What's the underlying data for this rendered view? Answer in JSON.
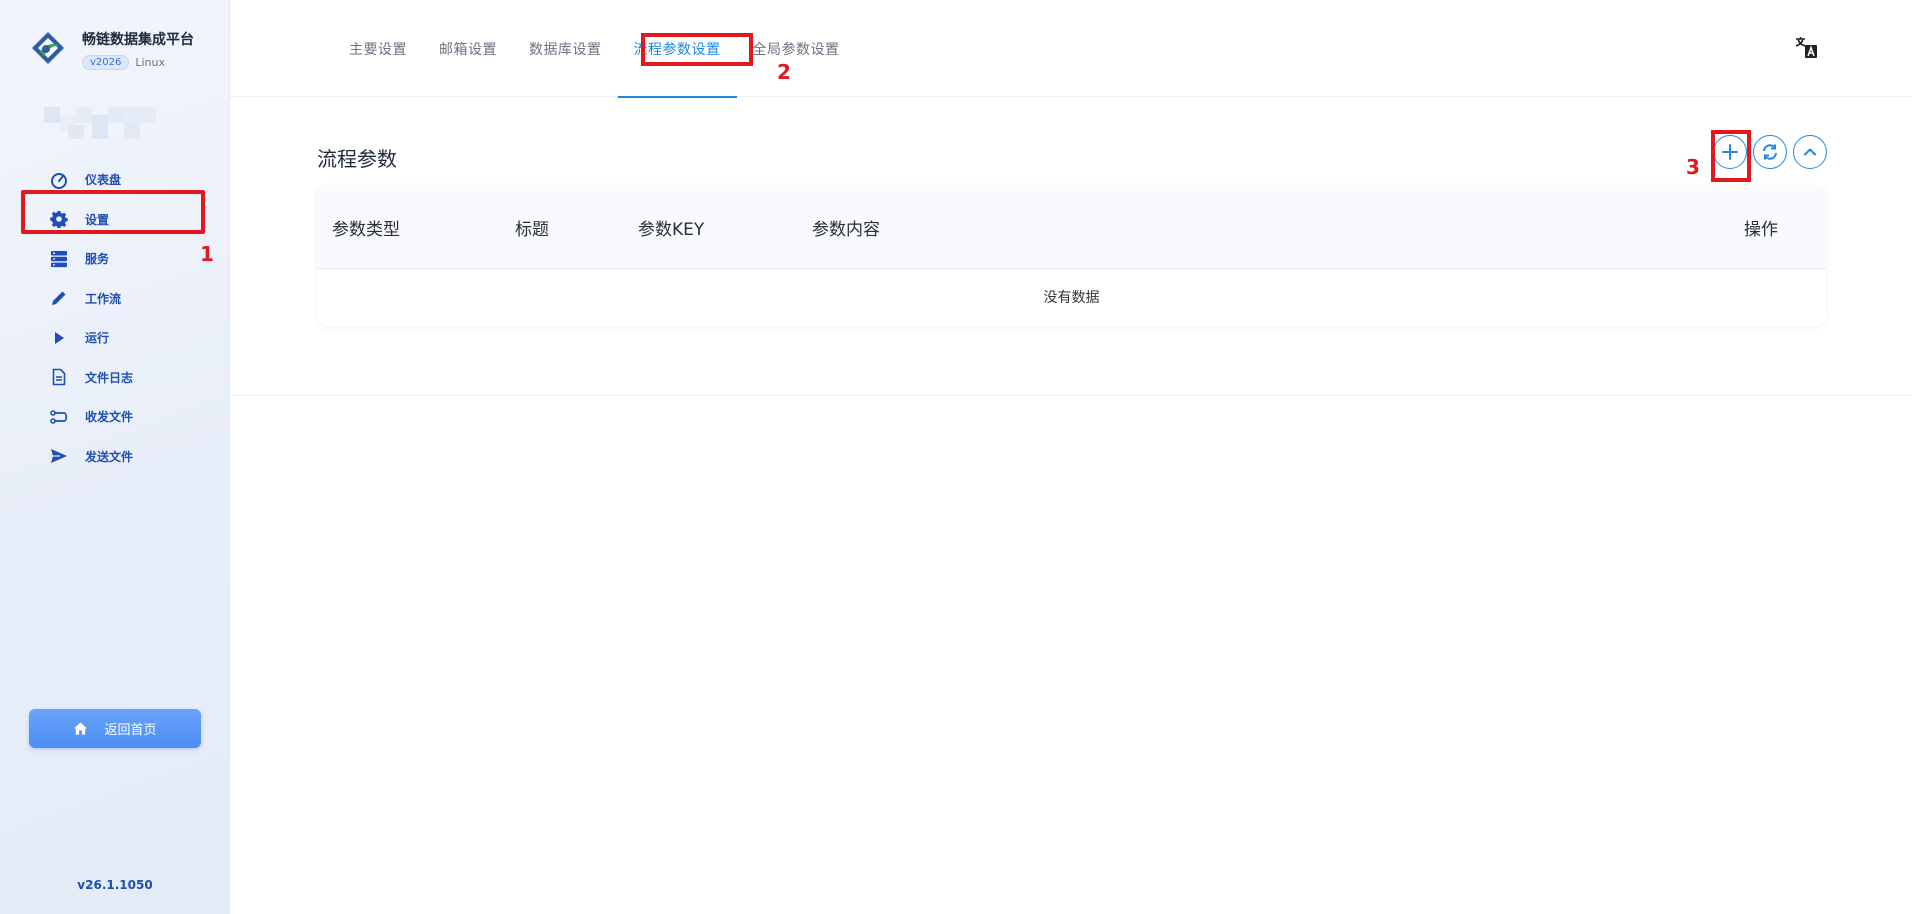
{
  "app": {
    "title": "畅链数据集成平台",
    "version_badge": "v2026",
    "os": "Linux",
    "build_version": "v26.1.1050"
  },
  "sidebar": {
    "items": [
      {
        "label": "仪表盘",
        "icon": "dashboard-gauge-icon"
      },
      {
        "label": "设置",
        "icon": "gear-icon"
      },
      {
        "label": "服务",
        "icon": "server-icon"
      },
      {
        "label": "工作流",
        "icon": "pencil-icon"
      },
      {
        "label": "运行",
        "icon": "play-icon"
      },
      {
        "label": "文件日志",
        "icon": "document-icon"
      },
      {
        "label": "收发文件",
        "icon": "transfer-icon"
      },
      {
        "label": "发送文件",
        "icon": "send-icon"
      }
    ],
    "home_button": "返回首页"
  },
  "tabs": [
    {
      "label": "主要设置",
      "active": false
    },
    {
      "label": "邮箱设置",
      "active": false
    },
    {
      "label": "数据库设置",
      "active": false
    },
    {
      "label": "流程参数设置",
      "active": true
    },
    {
      "label": "全局参数设置",
      "active": false
    }
  ],
  "main": {
    "section_title": "流程参数",
    "actions": [
      "add-icon",
      "refresh-icon",
      "collapse-icon"
    ],
    "table": {
      "headers": [
        "参数类型",
        "标题",
        "参数KEY",
        "参数内容",
        "操作"
      ],
      "rows": [],
      "empty_text": "没有数据"
    }
  },
  "annotations": {
    "step1": "1",
    "step2": "2",
    "step3": "3",
    "color": "#e0191f"
  },
  "colors": {
    "accent": "#1e88e5",
    "nav_text": "#1f4fb2"
  }
}
